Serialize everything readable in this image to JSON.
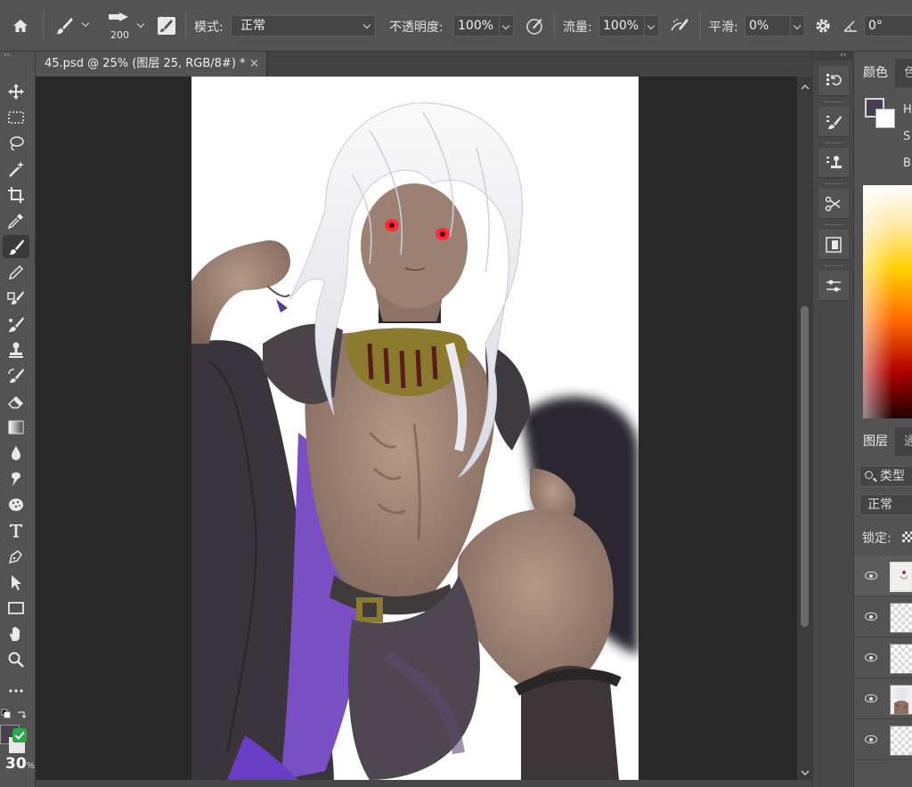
{
  "options_bar": {
    "brush_size": "200",
    "mode_label": "模式:",
    "mode_value": "正常",
    "opacity_label": "不透明度:",
    "opacity_value": "100%",
    "flow_label": "流量:",
    "flow_value": "100%",
    "smoothing_label": "平滑:",
    "smoothing_value": "0%",
    "angle_value": "0°"
  },
  "document_tab": {
    "title": "45.psd @ 25% (图层 25, RGB/8#) *",
    "close": "×"
  },
  "toolbar": {
    "tools": [
      "move-tool",
      "marquee-tool",
      "lasso-tool",
      "magic-wand-tool",
      "crop-tool",
      "eyedropper-tool",
      "brush-tool",
      "pencil-tool",
      "clone-stamp-tool",
      "mixer-brush-tool",
      "stamp-tool",
      "history-brush-tool",
      "eraser-tool",
      "gradient-tool",
      "blur-tool",
      "smudge-tool",
      "sponge-tool",
      "type-tool",
      "pen-tool",
      "path-selection-tool",
      "rectangle-tool",
      "hand-tool",
      "zoom-tool",
      "more-tools"
    ],
    "active_tool": "brush-tool",
    "brush_percent": "30",
    "percent_sign": "%",
    "foreground_color": "#4a3f50",
    "background_color": "#ffffff"
  },
  "right_panel": {
    "color_tab": "颜色",
    "color_tab_cut": "色",
    "h_label": "H",
    "s_label": "S",
    "b_label": "B",
    "layers_tab": "图层",
    "channels_tab_cut": "通",
    "search_label": "类型",
    "blend_mode": "正常",
    "lock_label": "锁定:",
    "layers": [
      {
        "selected": true,
        "type": "art"
      },
      {
        "selected": false,
        "type": "empty"
      },
      {
        "selected": false,
        "type": "empty"
      },
      {
        "selected": false,
        "type": "art"
      },
      {
        "selected": false,
        "type": "empty"
      }
    ]
  },
  "accent_colors": {
    "ui_bg": "#535353",
    "canvas_bg": "#282828",
    "highlight_purple": "#7a4fc4"
  }
}
